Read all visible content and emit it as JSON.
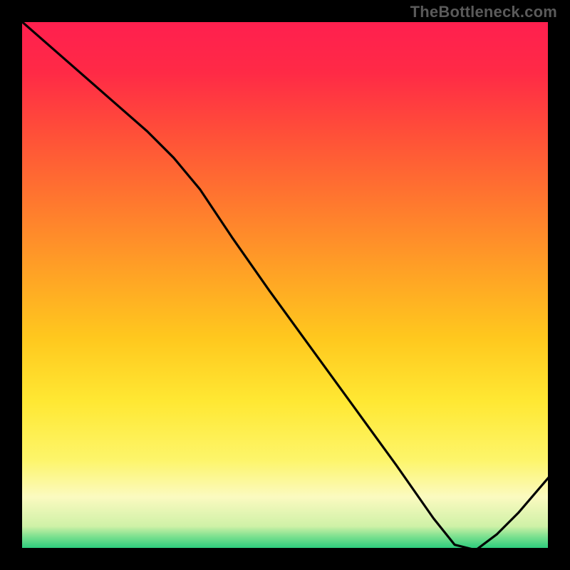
{
  "watermark": "TheBottleneck.com",
  "chart_data": {
    "type": "line",
    "title": "",
    "xlabel": "",
    "ylabel": "",
    "x": [
      0.0,
      0.08,
      0.16,
      0.24,
      0.29,
      0.34,
      0.4,
      0.47,
      0.55,
      0.63,
      0.71,
      0.78,
      0.82,
      0.86,
      0.9,
      0.94,
      1.0
    ],
    "y": [
      1.0,
      0.93,
      0.86,
      0.79,
      0.74,
      0.68,
      0.59,
      0.49,
      0.38,
      0.27,
      0.16,
      0.06,
      0.01,
      0.0,
      0.03,
      0.07,
      0.14
    ],
    "xlim": [
      0,
      1
    ],
    "ylim": [
      0,
      1
    ],
    "line_color": "#000000",
    "gradient_stops": [
      {
        "offset": 0.0,
        "color": "#ff1f4f"
      },
      {
        "offset": 0.1,
        "color": "#ff2a46"
      },
      {
        "offset": 0.22,
        "color": "#ff5138"
      },
      {
        "offset": 0.35,
        "color": "#ff7a2e"
      },
      {
        "offset": 0.48,
        "color": "#ffa325"
      },
      {
        "offset": 0.6,
        "color": "#ffc81e"
      },
      {
        "offset": 0.72,
        "color": "#ffe833"
      },
      {
        "offset": 0.83,
        "color": "#fdf56a"
      },
      {
        "offset": 0.9,
        "color": "#fbfac0"
      },
      {
        "offset": 0.955,
        "color": "#cff1a7"
      },
      {
        "offset": 0.975,
        "color": "#7ae08f"
      },
      {
        "offset": 1.0,
        "color": "#1fc97a"
      }
    ],
    "marker": {
      "text": "",
      "x": 0.82,
      "y": 0.005,
      "color": "#e03a2a",
      "font_size": 11
    }
  }
}
